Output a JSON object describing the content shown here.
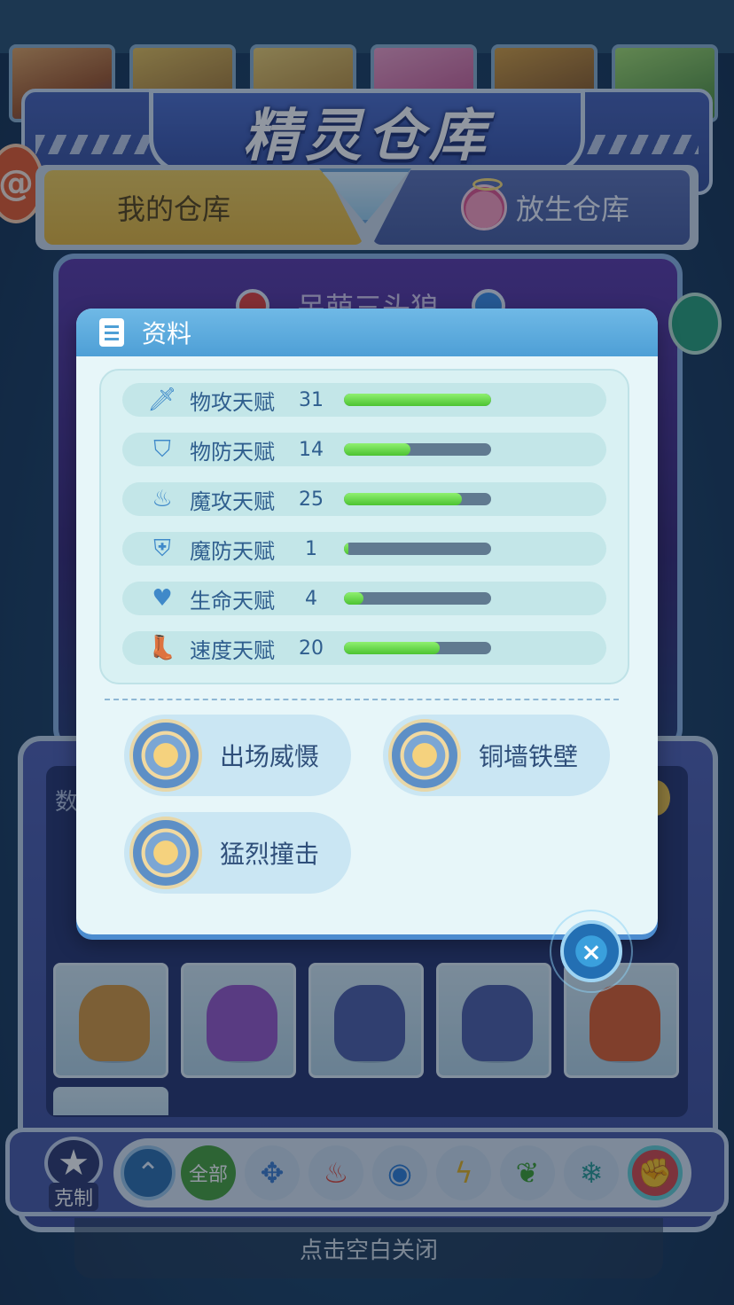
{
  "header": {
    "title": "精灵仓库"
  },
  "tabs": {
    "my_storage": "我的仓库",
    "release_storage": "放生仓库"
  },
  "stage": {
    "pet_name": "呆萌三头狼"
  },
  "popup": {
    "title": "资料",
    "stats": [
      {
        "label": "物攻天赋",
        "value": "31",
        "fill": 1.0,
        "icon": "sword-icon"
      },
      {
        "label": "物防天赋",
        "value": "14",
        "fill": 0.45,
        "icon": "shield-icon"
      },
      {
        "label": "魔攻天赋",
        "value": "25",
        "fill": 0.8,
        "icon": "flame-icon"
      },
      {
        "label": "魔防天赋",
        "value": "1",
        "fill": 0.03,
        "icon": "magic-shield-icon"
      },
      {
        "label": "生命天赋",
        "value": "4",
        "fill": 0.13,
        "icon": "heart-plus-icon"
      },
      {
        "label": "速度天赋",
        "value": "20",
        "fill": 0.65,
        "icon": "boot-icon"
      }
    ],
    "skills": [
      "出场威慑",
      "铜墙铁壁",
      "猛烈撞击"
    ],
    "close_icon": "×"
  },
  "storage": {
    "count_label": "数",
    "pets": [
      {
        "name": "lion-pet",
        "color": "#d99a3e"
      },
      {
        "name": "purple-knight-pet",
        "color": "#9a58c9"
      },
      {
        "name": "blue-wolf-pet",
        "color": "#4f5fa8"
      },
      {
        "name": "blue-wolf-pet",
        "color": "#4f5fa8"
      },
      {
        "name": "fire-warrior-pet",
        "color": "#e0602c"
      }
    ]
  },
  "filter": {
    "counter_label": "克制",
    "counter_glyph": "★",
    "all_label": "全部",
    "up_glyph": "⌃",
    "elements": [
      {
        "icon": "light-icon",
        "glyph": "✥",
        "color": "#3f7fd0"
      },
      {
        "icon": "fire-icon",
        "glyph": "♨",
        "color": "#e24a3a"
      },
      {
        "icon": "water-icon",
        "glyph": "◉",
        "color": "#2f7fd8"
      },
      {
        "icon": "lightning-icon",
        "glyph": "ϟ",
        "color": "#e6b21e"
      },
      {
        "icon": "grass-icon",
        "glyph": "❦",
        "color": "#3ea12e"
      },
      {
        "icon": "ice-icon",
        "glyph": "❄",
        "color": "#2a9d95"
      }
    ],
    "fist_glyph": "✊"
  },
  "close_hint": "点击空白关闭"
}
